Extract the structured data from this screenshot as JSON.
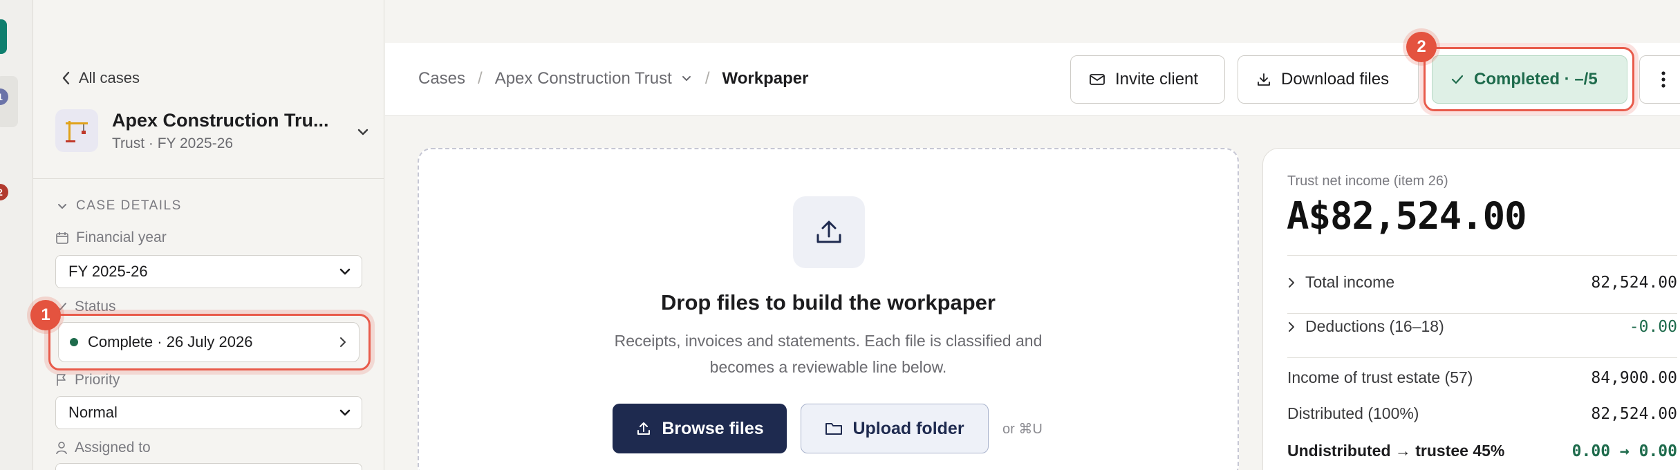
{
  "rail": {
    "badges": [
      "1",
      "2"
    ]
  },
  "sidebar": {
    "back_label": "All cases",
    "case_title": "Apex Construction Tru...",
    "case_sub": "Trust · FY 2025-26",
    "section_title": "CASE DETAILS",
    "financial_year": {
      "label": "Financial year",
      "value": "FY 2025-26"
    },
    "status": {
      "label": "Status",
      "value": "Complete · 26 July 2026"
    },
    "priority": {
      "label": "Priority",
      "value": "Normal"
    },
    "assigned": {
      "label": "Assigned to"
    }
  },
  "markers": {
    "one": "1",
    "two": "2"
  },
  "header": {
    "breadcrumbs": [
      "Cases",
      "Apex Construction Trust",
      "Workpaper"
    ],
    "separator": "/",
    "invite_label": "Invite client",
    "download_label": "Download files",
    "complete_label": "Completed · –/5"
  },
  "dropzone": {
    "title": "Drop files to build the workpaper",
    "subtitle_line1": "Receipts, invoices and statements. Each file is classified and",
    "subtitle_line2": "becomes a reviewable line below.",
    "browse_label": "Browse files",
    "folder_label": "Upload folder",
    "shortcut": "or ⌘U"
  },
  "summary": {
    "label": "Trust net income (item 26)",
    "amount": "A$82,524.00",
    "rows": [
      {
        "label": "Total income",
        "value": "82,524.00"
      },
      {
        "label": "Deductions (16–18)",
        "value": "-0.00"
      },
      {
        "label": "Income of trust estate (57)",
        "value": "84,900.00"
      },
      {
        "label": "Distributed (100%)",
        "value": "82,524.00"
      },
      {
        "label": "Undistributed → trustee 45%",
        "value": "0.00 → 0.00"
      }
    ]
  },
  "colors": {
    "accent": "#1e2a4f",
    "success": "#1e6b4c",
    "highlight": "#e85b4b",
    "brand": "#0f7f6e"
  }
}
